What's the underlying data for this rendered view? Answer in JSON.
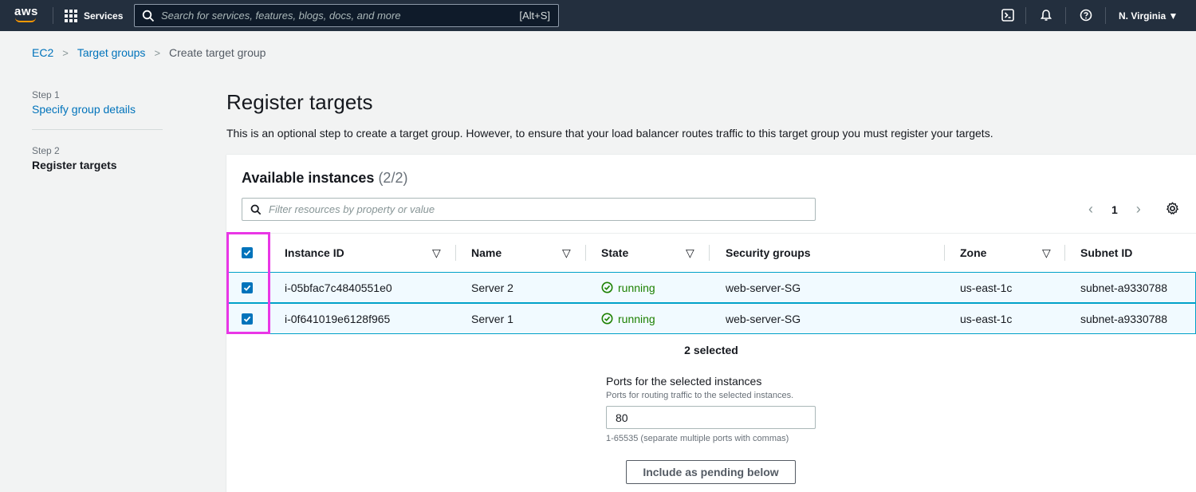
{
  "topnav": {
    "logo": "aws",
    "services_label": "Services",
    "search_placeholder": "Search for services, features, blogs, docs, and more",
    "search_shortcut": "[Alt+S]",
    "region": "N. Virginia ▼"
  },
  "breadcrumb": {
    "items": [
      "EC2",
      "Target groups",
      "Create target group"
    ]
  },
  "steps": [
    {
      "number": "Step 1",
      "title": "Specify group details"
    },
    {
      "number": "Step 2",
      "title": "Register targets"
    }
  ],
  "main": {
    "title": "Register targets",
    "description": "This is an optional step to create a target group. However, to ensure that your load balancer routes traffic to this target group you must register your targets."
  },
  "instances": {
    "title": "Available instances",
    "count": "(2/2)",
    "filter_placeholder": "Filter resources by property or value",
    "page": "1",
    "columns": [
      "Instance ID",
      "Name",
      "State",
      "Security groups",
      "Zone",
      "Subnet ID"
    ],
    "rows": [
      {
        "id": "i-05bfac7c4840551e0",
        "name": "Server 2",
        "state": "running",
        "sg": "web-server-SG",
        "zone": "us-east-1c",
        "subnet": "subnet-a9330788"
      },
      {
        "id": "i-0f641019e6128f965",
        "name": "Server 1",
        "state": "running",
        "sg": "web-server-SG",
        "zone": "us-east-1c",
        "subnet": "subnet-a9330788"
      }
    ],
    "selected_text": "2 selected"
  },
  "ports": {
    "label": "Ports for the selected instances",
    "description": "Ports for routing traffic to the selected instances.",
    "value": "80",
    "hint": "1-65535 (separate multiple ports with commas)",
    "button": "Include as pending below"
  },
  "colors": {
    "nav_bg": "#232f3e",
    "link": "#0073bb",
    "running": "#1d8102",
    "row_selected_bg": "#f1faff",
    "row_selected_border": "#00a1c9",
    "highlight": "#e936e6"
  }
}
